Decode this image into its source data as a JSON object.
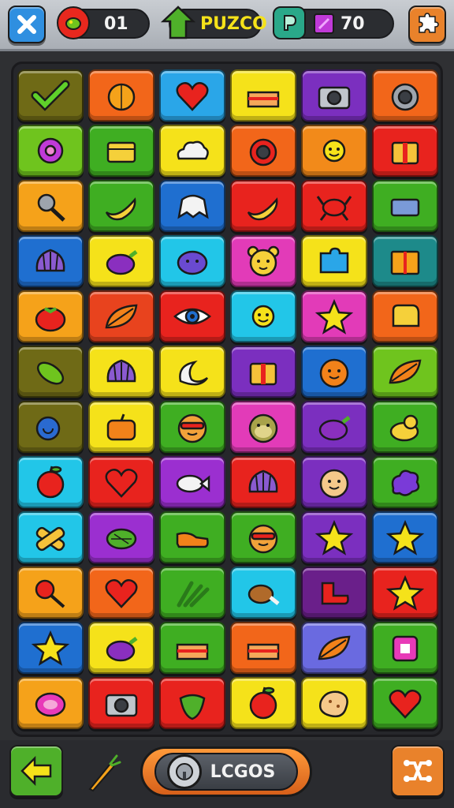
{
  "header": {
    "lives_value": "01",
    "title_label": "PUZCO",
    "coins_value": "70",
    "colors": {
      "close": "#2f8fe0",
      "puzzle": "#e9822b",
      "pill": "#2b2d31"
    }
  },
  "board": {
    "rows": [
      [
        {
          "bg": "#6f6a16",
          "icon": "check-icon"
        },
        {
          "bg": "#f2661a",
          "icon": "orange-fruit-icon"
        },
        {
          "bg": "#2aa6e8",
          "icon": "heart-icon"
        },
        {
          "bg": "#f5e21a",
          "icon": "cake-slice-icon"
        },
        {
          "bg": "#7b2fbf",
          "icon": "camera-icon"
        },
        {
          "bg": "#f2661a",
          "icon": "speaker-icon"
        }
      ],
      [
        {
          "bg": "#6fc41e",
          "icon": "flower-icon"
        },
        {
          "bg": "#3fae22",
          "icon": "box-icon"
        },
        {
          "bg": "#f5e21a",
          "icon": "cloud-icon"
        },
        {
          "bg": "#f2661a",
          "icon": "camera-lens-icon"
        },
        {
          "bg": "#f28a1a",
          "icon": "sun-face-icon"
        },
        {
          "bg": "#e8231e",
          "icon": "gift-box-icon"
        }
      ],
      [
        {
          "bg": "#f5a21a",
          "icon": "magnifier-icon"
        },
        {
          "bg": "#3fae22",
          "icon": "banana-icon"
        },
        {
          "bg": "#1f6fd0",
          "icon": "ghost-icon"
        },
        {
          "bg": "#e8231e",
          "icon": "banana-icon"
        },
        {
          "bg": "#e8231e",
          "icon": "crab-icon"
        },
        {
          "bg": "#3fae22",
          "icon": "tag-icon"
        }
      ],
      [
        {
          "bg": "#1f6fd0",
          "icon": "shell-icon"
        },
        {
          "bg": "#f5e21a",
          "icon": "eggplant-icon"
        },
        {
          "bg": "#22c6e8",
          "icon": "blob-face-icon"
        },
        {
          "bg": "#e23bb8",
          "icon": "bear-face-icon"
        },
        {
          "bg": "#f5e21a",
          "icon": "puzzle-piece-icon"
        },
        {
          "bg": "#1d8a8a",
          "icon": "book-icon"
        }
      ],
      [
        {
          "bg": "#f5a21a",
          "icon": "tomato-icon"
        },
        {
          "bg": "#e8431e",
          "icon": "leaf-icon"
        },
        {
          "bg": "#e8231e",
          "icon": "eye-icon"
        },
        {
          "bg": "#22c6e8",
          "icon": "sun-face-icon"
        },
        {
          "bg": "#e23bb8",
          "icon": "star-icon"
        },
        {
          "bg": "#f2661a",
          "icon": "glove-icon"
        }
      ],
      [
        {
          "bg": "#6f6a16",
          "icon": "corn-icon"
        },
        {
          "bg": "#f5e21a",
          "icon": "shell-icon"
        },
        {
          "bg": "#f5e21a",
          "icon": "moon-icon"
        },
        {
          "bg": "#7b2fbf",
          "icon": "gift-box-icon"
        },
        {
          "bg": "#1f6fd0",
          "icon": "orange-face-icon"
        },
        {
          "bg": "#6fc41e",
          "icon": "leaf-icon"
        }
      ],
      [
        {
          "bg": "#6f6a16",
          "icon": "snail-icon"
        },
        {
          "bg": "#f5e21a",
          "icon": "pumpkin-icon"
        },
        {
          "bg": "#3fae22",
          "icon": "sunglasses-face-icon"
        },
        {
          "bg": "#e23bb8",
          "icon": "monkey-face-icon"
        },
        {
          "bg": "#7b2fbf",
          "icon": "eggplant-icon"
        },
        {
          "bg": "#3fae22",
          "icon": "duck-icon"
        }
      ],
      [
        {
          "bg": "#22c6e8",
          "icon": "apple-icon"
        },
        {
          "bg": "#e8231e",
          "icon": "heart-icon"
        },
        {
          "bg": "#9b2fd0",
          "icon": "fish-icon"
        },
        {
          "bg": "#e8231e",
          "icon": "shell-icon"
        },
        {
          "bg": "#7b2fbf",
          "icon": "cookie-face-icon"
        },
        {
          "bg": "#3fae22",
          "icon": "splat-icon"
        }
      ],
      [
        {
          "bg": "#22c6e8",
          "icon": "bandage-icon"
        },
        {
          "bg": "#9b2fd0",
          "icon": "melon-icon"
        },
        {
          "bg": "#3fae22",
          "icon": "shoe-icon"
        },
        {
          "bg": "#3fae22",
          "icon": "sunglasses-face-icon"
        },
        {
          "bg": "#7b2fbf",
          "icon": "star-icon"
        },
        {
          "bg": "#1f6fd0",
          "icon": "star-icon"
        }
      ],
      [
        {
          "bg": "#f5a21a",
          "icon": "lollipop-icon"
        },
        {
          "bg": "#f2661a",
          "icon": "heart-icon"
        },
        {
          "bg": "#3fae22",
          "icon": "grass-icon"
        },
        {
          "bg": "#22c6e8",
          "icon": "drumstick-icon"
        },
        {
          "bg": "#6a1f8a",
          "icon": "boot-icon"
        },
        {
          "bg": "#e8231e",
          "icon": "star-icon"
        }
      ],
      [
        {
          "bg": "#1f6fd0",
          "icon": "star-icon"
        },
        {
          "bg": "#f5e21a",
          "icon": "eggplant-icon"
        },
        {
          "bg": "#3fae22",
          "icon": "cake-slice-icon"
        },
        {
          "bg": "#f2661a",
          "icon": "cake-slice-icon"
        },
        {
          "bg": "#6a6ae0",
          "icon": "leaf-icon"
        },
        {
          "bg": "#3fae22",
          "icon": "dice-icon"
        }
      ],
      [
        {
          "bg": "#f5a21a",
          "icon": "ham-icon"
        },
        {
          "bg": "#e8231e",
          "icon": "camera-icon"
        },
        {
          "bg": "#e8231e",
          "icon": "strawberry-icon"
        },
        {
          "bg": "#f5e21a",
          "icon": "apple-icon"
        },
        {
          "bg": "#f5e21a",
          "icon": "cookie-icon"
        },
        {
          "bg": "#3fae22",
          "icon": "heart-icon"
        }
      ]
    ]
  },
  "footer": {
    "center_label": "LCGOS",
    "colors": {
      "back": "#4fb02a",
      "shuffle": "#e9822b"
    }
  }
}
